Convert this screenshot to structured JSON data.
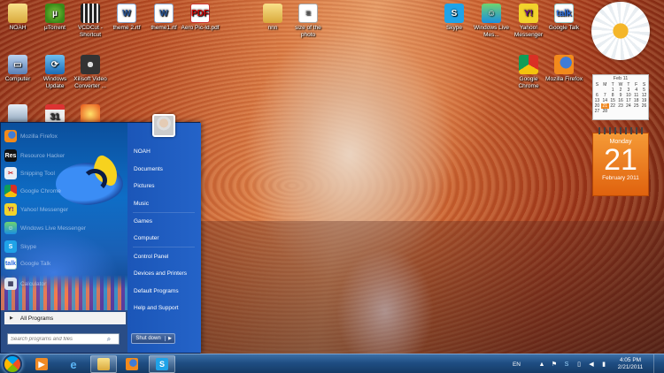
{
  "desktop": {
    "icons_row1": [
      {
        "label": "NOAH",
        "icon": "folder-icon"
      },
      {
        "label": "µTorrent",
        "icon": "utorrent-icon"
      },
      {
        "label": "VCDCut - Shortcut",
        "icon": "film-icon"
      },
      {
        "label": "theme 2.rtf",
        "icon": "document-icon"
      },
      {
        "label": "theme1.rtf",
        "icon": "document-icon"
      },
      {
        "label": "Aero Pic-Id.pdf",
        "icon": "pdf-icon"
      },
      {
        "label": "nnn",
        "icon": "folder-icon"
      },
      {
        "label": "size of the photo",
        "icon": "text-file-icon"
      },
      {
        "label": "Skype",
        "icon": "skype-icon"
      },
      {
        "label": "Windows Live Mes...",
        "icon": "messenger-icon"
      },
      {
        "label": "Yahoo! Messenger",
        "icon": "yahoo-icon"
      },
      {
        "label": "Google Talk",
        "icon": "google-talk-icon"
      }
    ],
    "icons_row2": [
      {
        "label": "Computer",
        "icon": "computer-icon"
      },
      {
        "label": "Windows Update",
        "icon": "windows-update-icon"
      },
      {
        "label": "Xilisoft Video Converter ...",
        "icon": "video-converter-icon"
      },
      {
        "label": "Google Chrome",
        "icon": "chrome-icon"
      },
      {
        "label": "Mozilla Firefox",
        "icon": "firefox-icon"
      }
    ],
    "icons_row3": [
      {
        "label": "",
        "icon": "recycle-bin-icon"
      },
      {
        "label": "",
        "icon": "calendar-app-icon"
      },
      {
        "label": "",
        "icon": "app-icon"
      }
    ]
  },
  "gadgets": {
    "mini_calendar": {
      "month_label": "Feb 11",
      "weekdays": [
        "S",
        "M",
        "T",
        "W",
        "T",
        "F",
        "S"
      ],
      "days": [
        "",
        "",
        "1",
        "2",
        "3",
        "4",
        "5",
        "6",
        "7",
        "8",
        "9",
        "10",
        "11",
        "12",
        "13",
        "14",
        "15",
        "16",
        "17",
        "18",
        "19",
        "20",
        "21",
        "22",
        "23",
        "24",
        "25",
        "26",
        "27",
        "28",
        "",
        "",
        "",
        "",
        "",
        ""
      ],
      "today": "21"
    },
    "big_calendar": {
      "weekday": "Monday",
      "day": "21",
      "month_year": "February 2011"
    }
  },
  "start_menu": {
    "user_name": "NOAH",
    "pinned_programs": [
      {
        "label": "Mozilla Firefox",
        "icon": "firefox-icon"
      },
      {
        "label": "Resource Hacker",
        "icon": "res-icon"
      },
      {
        "label": "Snipping Tool",
        "icon": "scissors-icon"
      },
      {
        "label": "Google Chrome",
        "icon": "chrome-icon"
      },
      {
        "label": "Yahoo! Messenger",
        "icon": "yahoo-icon"
      },
      {
        "label": "Windows Live Messenger",
        "icon": "messenger-icon"
      },
      {
        "label": "Skype",
        "icon": "skype-icon"
      },
      {
        "label": "Google Talk",
        "icon": "google-talk-icon"
      },
      {
        "label": "Calculator",
        "icon": "calculator-icon"
      }
    ],
    "all_programs": "All Programs",
    "search_placeholder": "Search programs and files",
    "right_links": [
      "NOAH",
      "Documents",
      "Pictures",
      "Music",
      "Games",
      "Computer",
      "Control Panel",
      "Devices and Printers",
      "Default Programs",
      "Help and Support"
    ],
    "shutdown_label": "Shut down"
  },
  "taskbar": {
    "pinned": [
      {
        "name": "media-player-icon"
      },
      {
        "name": "internet-explorer-icon"
      },
      {
        "name": "explorer-icon"
      },
      {
        "name": "firefox-icon"
      },
      {
        "name": "skype-icon"
      }
    ],
    "language": "EN",
    "time": "4:05 PM",
    "date": "2/21/2011"
  }
}
